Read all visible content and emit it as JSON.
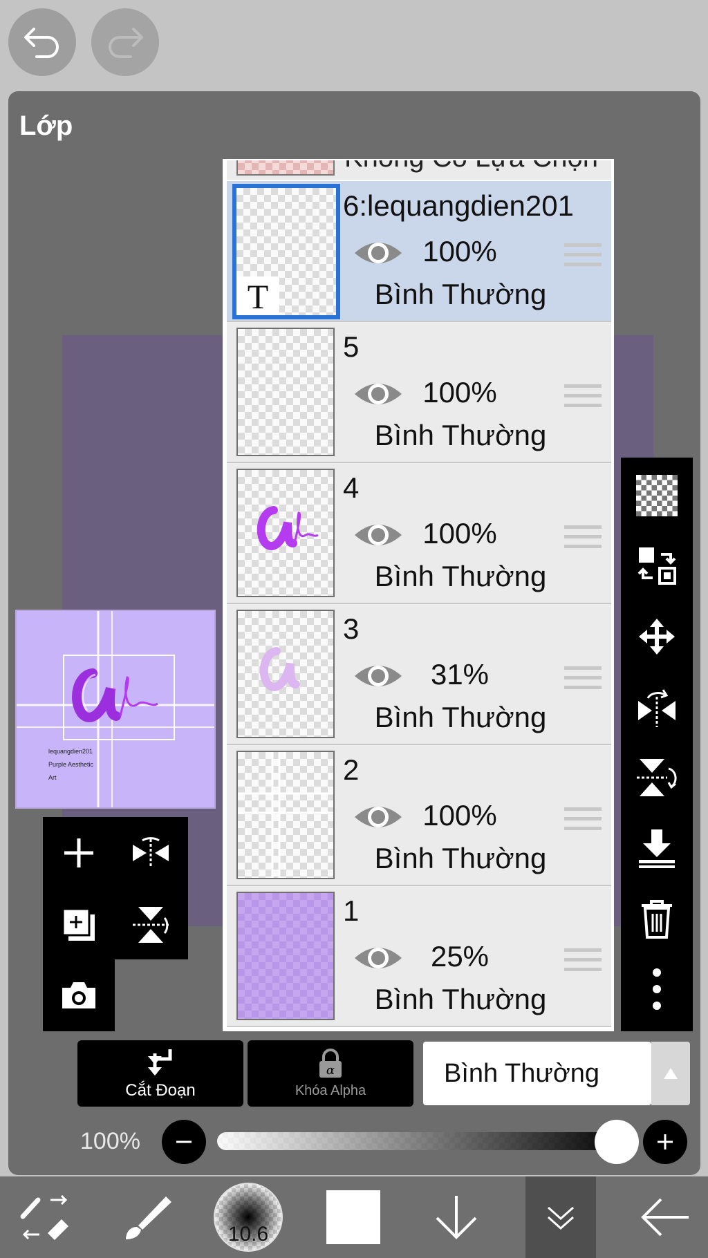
{
  "panel": {
    "title": "Lớp"
  },
  "layers": {
    "top_partial": "Không Có Lựa Chọn",
    "items": [
      {
        "name": "6:lequangdien201",
        "opacity": "100%",
        "blend": "Bình Thường",
        "thumb_glyph": "T",
        "selected": true
      },
      {
        "name": "5",
        "opacity": "100%",
        "blend": "Bình Thường"
      },
      {
        "name": "4",
        "opacity": "100%",
        "blend": "Bình Thường"
      },
      {
        "name": "3",
        "opacity": "31%",
        "blend": "Bình Thường"
      },
      {
        "name": "2",
        "opacity": "100%",
        "blend": "Bình Thường"
      },
      {
        "name": "1",
        "opacity": "25%",
        "blend": "Bình Thường"
      }
    ]
  },
  "preview": {
    "lines": [
      "lequangdien201",
      "Purple Aesthetic",
      "Art"
    ]
  },
  "actions": {
    "clipping_label": "Cắt Đoạn",
    "alpha_lock_label": "Khóa Alpha"
  },
  "blend_mode": {
    "selected": "Bình Thường"
  },
  "opacity_control": {
    "value_label": "100%",
    "value": 1.0
  },
  "bottom_toolbar": {
    "brush_size": "10.6"
  },
  "colors": {
    "accent": "#2a73d6",
    "selected_row": "#cad7ea",
    "letter": "#b43bf0"
  }
}
